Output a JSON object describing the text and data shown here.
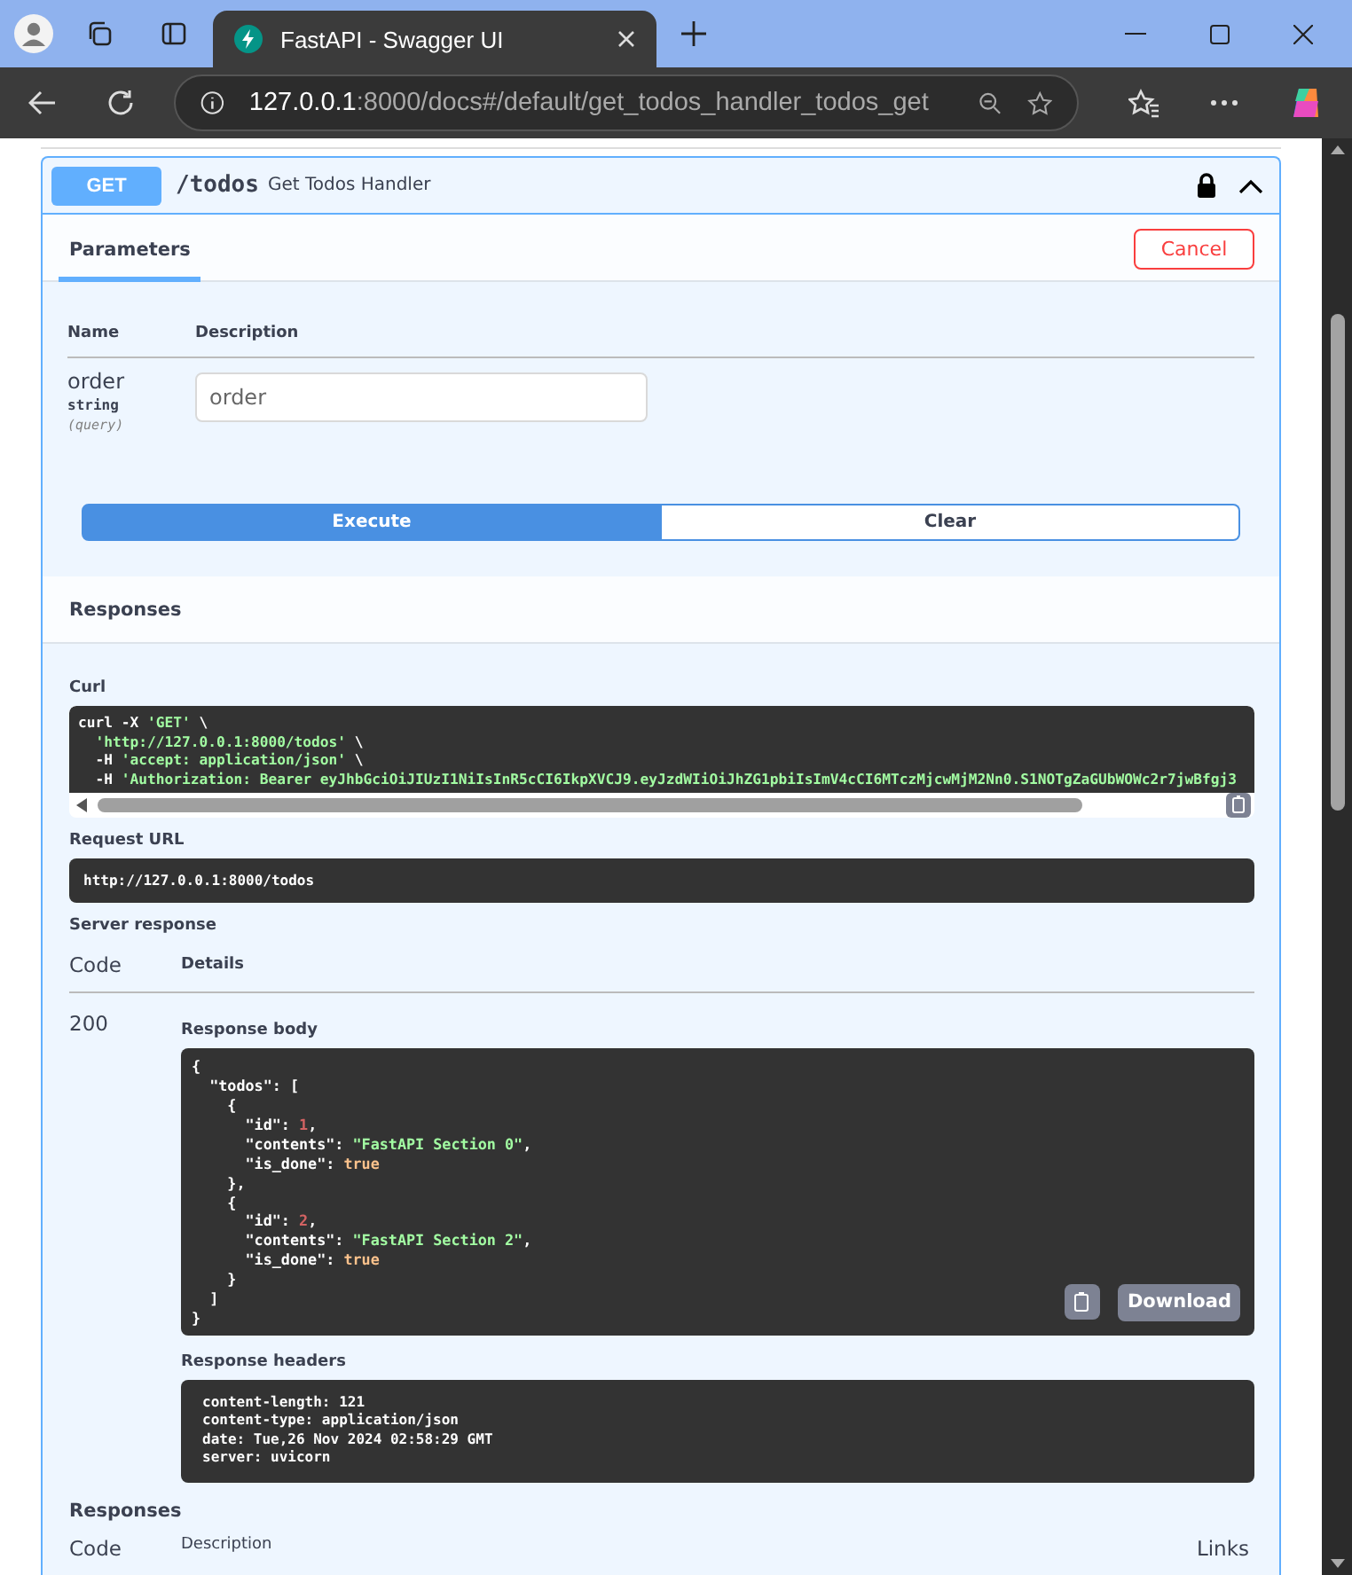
{
  "browser": {
    "tabs": [
      {
        "title": "FastAPI - Swagger UI",
        "selected": true
      }
    ],
    "url_host": "127.0.0.1",
    "url_rest": ":8000/docs#/default/get_todos_handler_todos_get"
  },
  "operation": {
    "method": "GET",
    "path": "/todos",
    "summary": "Get Todos Handler",
    "expanded": true,
    "params_tab": "Parameters",
    "cancel": "Cancel",
    "param_columns": [
      "Name",
      "Description"
    ],
    "params": [
      {
        "name": "order",
        "type": "string",
        "location": "(query)",
        "placeholder": "order"
      }
    ],
    "execute": "Execute",
    "clear": "Clear",
    "responses_title": "Responses",
    "curl_label": "Curl",
    "curl": {
      "command": [
        {
          "t": "curl -X ",
          "kind": "plain"
        },
        {
          "t": "'GET'",
          "kind": "string"
        },
        {
          "t": " \\",
          "kind": "plain"
        }
      ],
      "options": [
        [
          {
            "t": "'http://127.0.0.1:8000/todos'",
            "kind": "string"
          },
          {
            "t": " \\",
            "kind": "plain"
          }
        ],
        [
          {
            "t": "-H ",
            "kind": "plain"
          },
          {
            "t": "'accept: application/json'",
            "kind": "string"
          },
          {
            "t": " \\",
            "kind": "plain"
          }
        ],
        [
          {
            "t": "-H ",
            "kind": "plain"
          },
          {
            "t": "'Authorization: Bearer eyJhbGciOiJIUzI1NiIsInR5cCI6IkpXVCJ9.eyJzdWIiOiJhZG1pbiIsImV4cCI6MTczMjcwMjM2Nn0.S1NOTgZaGUbWOWc2r7jwBfgj3",
            "kind": "string"
          }
        ]
      ]
    },
    "request_url_label": "Request URL",
    "request_url": "http://127.0.0.1:8000/todos",
    "server_response_label": "Server response",
    "response_columns": [
      "Code",
      "Details"
    ],
    "code": "200",
    "body_label": "Response body",
    "body": [
      [
        {
          "t": "{",
          "kind": "plain"
        }
      ],
      [
        {
          "t": "  \"todos\": [",
          "kind": "plain"
        }
      ],
      [
        {
          "t": "    {",
          "kind": "plain"
        }
      ],
      [
        {
          "t": "      \"id\": ",
          "kind": "plain"
        },
        {
          "t": "1",
          "kind": "number"
        },
        {
          "t": ",",
          "kind": "plain"
        }
      ],
      [
        {
          "t": "      \"contents\": ",
          "kind": "plain"
        },
        {
          "t": "\"FastAPI Section 0\"",
          "kind": "string"
        },
        {
          "t": ",",
          "kind": "plain"
        }
      ],
      [
        {
          "t": "      \"is_done\": ",
          "kind": "plain"
        },
        {
          "t": "true",
          "kind": "bool"
        }
      ],
      [
        {
          "t": "    },",
          "kind": "plain"
        }
      ],
      [
        {
          "t": "    {",
          "kind": "plain"
        }
      ],
      [
        {
          "t": "      \"id\": ",
          "kind": "plain"
        },
        {
          "t": "2",
          "kind": "number"
        },
        {
          "t": ",",
          "kind": "plain"
        }
      ],
      [
        {
          "t": "      \"contents\": ",
          "kind": "plain"
        },
        {
          "t": "\"FastAPI Section 2\"",
          "kind": "string"
        },
        {
          "t": ",",
          "kind": "plain"
        }
      ],
      [
        {
          "t": "      \"is_done\": ",
          "kind": "plain"
        },
        {
          "t": "true",
          "kind": "bool"
        }
      ],
      [
        {
          "t": "    }",
          "kind": "plain"
        }
      ],
      [
        {
          "t": "  ]",
          "kind": "plain"
        }
      ],
      [
        {
          "t": "}",
          "kind": "plain"
        }
      ]
    ],
    "download": "Download",
    "headers_label": "Response headers",
    "headers": [
      "content-length: 121",
      "content-type: application/json",
      "date: Tue,26 Nov 2024 02:58:29 GMT",
      "server: uvicorn"
    ],
    "responses_title_2": "Responses",
    "bottom_columns": [
      "Code",
      "Description",
      "Links"
    ]
  }
}
